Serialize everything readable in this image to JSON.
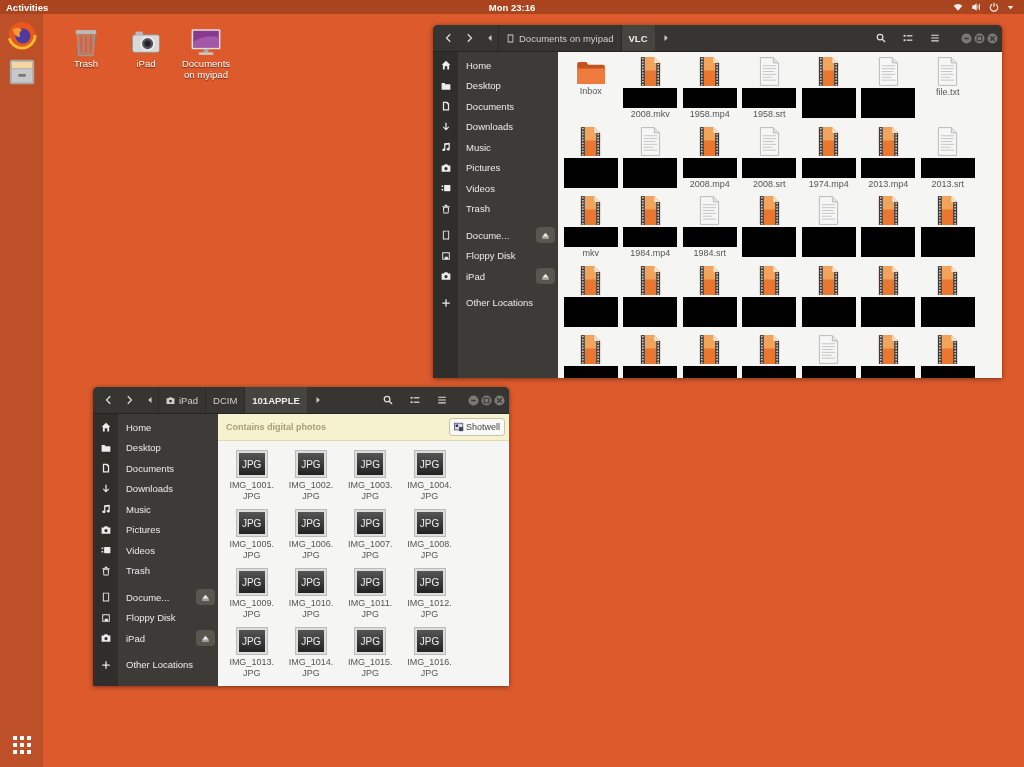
{
  "top_bar": {
    "activities": "Activities",
    "clock": "Mon 23:16"
  },
  "desktop_icons": [
    {
      "kind": "trash",
      "label": "Trash"
    },
    {
      "kind": "camera",
      "label": "iPad"
    },
    {
      "kind": "monitor",
      "label": "Documents on myipad"
    }
  ],
  "windows": [
    {
      "path": [
        {
          "kind": "drive",
          "label": "Documents on myipad",
          "selected": false
        },
        {
          "label": "VLC",
          "selected": true
        }
      ],
      "sidebar_groups": [
        {
          "items": [
            {
              "kind": "home",
              "label": "Home",
              "eject": false
            },
            {
              "kind": "folder",
              "label": "Desktop",
              "eject": false
            },
            {
              "kind": "document",
              "label": "Documents",
              "eject": false
            },
            {
              "kind": "download",
              "label": "Downloads",
              "eject": false
            },
            {
              "kind": "music",
              "label": "Music",
              "eject": false
            },
            {
              "kind": "camera",
              "label": "Pictures",
              "eject": false
            },
            {
              "kind": "video",
              "label": "Videos",
              "eject": false
            },
            {
              "kind": "trash",
              "label": "Trash",
              "eject": false
            }
          ]
        },
        {
          "items": [
            {
              "kind": "drive",
              "label": "Docume...",
              "eject": true
            },
            {
              "kind": "floppy",
              "label": "Floppy Disk",
              "eject": false
            },
            {
              "kind": "camera",
              "label": "iPad",
              "eject": true
            }
          ]
        },
        {
          "items": [
            {
              "kind": "plus",
              "label": "Other Locations",
              "eject": false
            }
          ]
        }
      ],
      "files": [
        {
          "kind": "folder",
          "label": "Inbox",
          "redacted": false
        },
        {
          "kind": "video",
          "label": "2008.mkv",
          "redacted": true
        },
        {
          "kind": "video",
          "label": "1958.mp4",
          "redacted": true
        },
        {
          "kind": "text",
          "label": "1958.srt",
          "redacted": true
        },
        {
          "kind": "video",
          "redacted": true
        },
        {
          "kind": "text",
          "redacted": true
        },
        {
          "kind": "text",
          "label": "file.txt",
          "redacted": false
        },
        {
          "kind": "video",
          "redacted": true
        },
        {
          "kind": "text",
          "redacted": true
        },
        {
          "kind": "video",
          "label": "2008.mp4",
          "redacted": true
        },
        {
          "kind": "text",
          "label": "2008.srt",
          "redacted": true
        },
        {
          "kind": "video",
          "label": "1974.mp4",
          "redacted": true
        },
        {
          "kind": "video",
          "label": "2013.mp4",
          "redacted": true
        },
        {
          "kind": "text",
          "label": "2013.srt",
          "redacted": true
        },
        {
          "kind": "video",
          "label": "mkv",
          "redacted": true
        },
        {
          "kind": "video",
          "label": "1984.mp4",
          "redacted": true
        },
        {
          "kind": "text",
          "label": "1984.srt",
          "redacted": true
        },
        {
          "kind": "video",
          "redacted": true
        },
        {
          "kind": "text",
          "redacted": true
        },
        {
          "kind": "video",
          "redacted": true
        },
        {
          "kind": "video",
          "redacted": true
        },
        {
          "kind": "video",
          "redacted": true
        },
        {
          "kind": "video",
          "redacted": true
        },
        {
          "kind": "video",
          "redacted": true
        },
        {
          "kind": "video",
          "redacted": true
        },
        {
          "kind": "video",
          "redacted": true
        },
        {
          "kind": "video",
          "redacted": true
        },
        {
          "kind": "video",
          "redacted": true
        },
        {
          "kind": "video",
          "redacted": true
        },
        {
          "kind": "video",
          "redacted": true
        },
        {
          "kind": "video",
          "redacted": true
        },
        {
          "kind": "video",
          "redacted": true
        },
        {
          "kind": "text",
          "redacted": true
        },
        {
          "kind": "video",
          "redacted": true
        },
        {
          "kind": "video",
          "redacted": true
        }
      ]
    },
    {
      "path": [
        {
          "kind": "camera",
          "label": "iPad",
          "selected": false
        },
        {
          "label": "DCIM",
          "selected": false
        },
        {
          "label": "101APPLE",
          "selected": true
        }
      ],
      "sidebar_groups": [
        {
          "items": [
            {
              "kind": "home",
              "label": "Home",
              "eject": false
            },
            {
              "kind": "folder",
              "label": "Desktop",
              "eject": false
            },
            {
              "kind": "document",
              "label": "Documents",
              "eject": false
            },
            {
              "kind": "download",
              "label": "Downloads",
              "eject": false
            },
            {
              "kind": "music",
              "label": "Music",
              "eject": false
            },
            {
              "kind": "camera",
              "label": "Pictures",
              "eject": false
            },
            {
              "kind": "video",
              "label": "Videos",
              "eject": false
            },
            {
              "kind": "trash",
              "label": "Trash",
              "eject": false
            }
          ]
        },
        {
          "items": [
            {
              "kind": "drive",
              "label": "Docume...",
              "eject": true
            },
            {
              "kind": "floppy",
              "label": "Floppy Disk",
              "eject": false
            },
            {
              "kind": "camera",
              "label": "iPad",
              "eject": true
            }
          ]
        },
        {
          "items": [
            {
              "kind": "plus",
              "label": "Other Locations",
              "eject": false
            }
          ]
        }
      ],
      "info_bar": {
        "message": "Contains digital photos",
        "button": "Shotwell"
      },
      "files": [
        {
          "kind": "image",
          "badge": "JPG",
          "label": "IMG_1001.JPG",
          "redacted": false
        },
        {
          "kind": "image",
          "badge": "JPG",
          "label": "IMG_1002.JPG",
          "redacted": false
        },
        {
          "kind": "image",
          "badge": "JPG",
          "label": "IMG_1003.JPG",
          "redacted": false
        },
        {
          "kind": "image",
          "badge": "JPG",
          "label": "IMG_1004.JPG",
          "redacted": false
        },
        {
          "kind": "image",
          "badge": "JPG",
          "label": "IMG_1005.JPG",
          "redacted": false
        },
        {
          "kind": "image",
          "badge": "JPG",
          "label": "IMG_1006.JPG",
          "redacted": false
        },
        {
          "kind": "image",
          "badge": "JPG",
          "label": "IMG_1007.JPG",
          "redacted": false
        },
        {
          "kind": "image",
          "badge": "JPG",
          "label": "IMG_1008.JPG",
          "redacted": false
        },
        {
          "kind": "image",
          "badge": "JPG",
          "label": "IMG_1009.JPG",
          "redacted": false
        },
        {
          "kind": "image",
          "badge": "JPG",
          "label": "IMG_1010.JPG",
          "redacted": false
        },
        {
          "kind": "image",
          "badge": "JPG",
          "label": "IMG_1011.JPG",
          "redacted": false
        },
        {
          "kind": "image",
          "badge": "JPG",
          "label": "IMG_1012.JPG",
          "redacted": false
        },
        {
          "kind": "image",
          "badge": "JPG",
          "label": "IMG_1013.JPG",
          "redacted": false
        },
        {
          "kind": "image",
          "badge": "JPG",
          "label": "IMG_1014.JPG",
          "redacted": false
        },
        {
          "kind": "image",
          "badge": "JPG",
          "label": "IMG_1015.JPG",
          "redacted": false
        },
        {
          "kind": "image",
          "badge": "JPG",
          "label": "IMG_1016.JPG",
          "redacted": false
        }
      ]
    }
  ]
}
